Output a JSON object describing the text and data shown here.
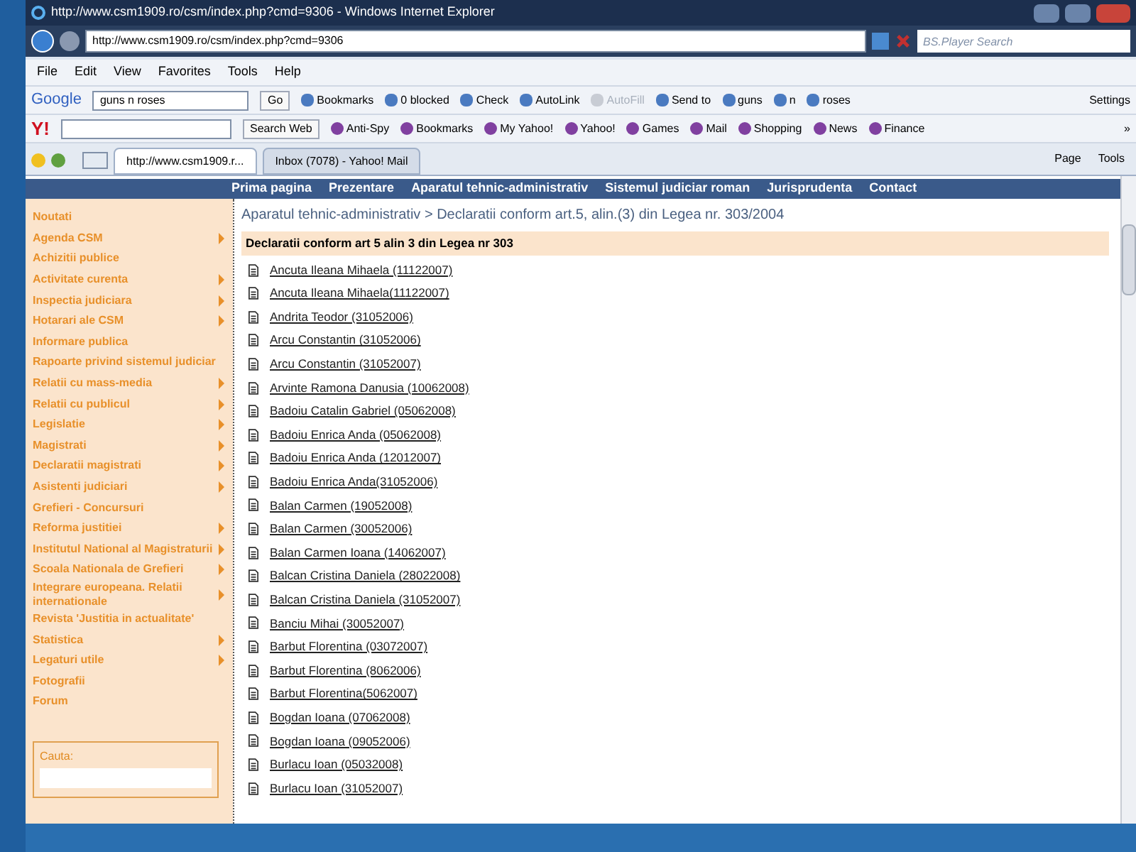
{
  "window": {
    "title": "http://www.csm1909.ro/csm/index.php?cmd=9306 - Windows Internet Explorer"
  },
  "address_bar": {
    "url": "http://www.csm1909.ro/csm/index.php?cmd=9306",
    "search_placeholder": "BS.Player Search"
  },
  "menu": [
    "File",
    "Edit",
    "View",
    "Favorites",
    "Tools",
    "Help"
  ],
  "google_toolbar": {
    "logo": "Google",
    "query": "guns n roses",
    "go": "Go",
    "items": [
      {
        "label": "Bookmarks",
        "disabled": false
      },
      {
        "label": "0 blocked",
        "disabled": false
      },
      {
        "label": "Check",
        "disabled": false
      },
      {
        "label": "AutoLink",
        "disabled": false
      },
      {
        "label": "AutoFill",
        "disabled": true
      },
      {
        "label": "Send to",
        "disabled": false
      },
      {
        "label": "guns",
        "disabled": false
      },
      {
        "label": "n",
        "disabled": false
      },
      {
        "label": "roses",
        "disabled": false
      }
    ],
    "settings": "Settings"
  },
  "yahoo_toolbar": {
    "logo": "Y!",
    "search_button": "Search Web",
    "items": [
      "Anti-Spy",
      "Bookmarks",
      "My Yahoo!",
      "Yahoo!",
      "Games",
      "Mail",
      "Shopping",
      "News",
      "Finance"
    ],
    "more": "»"
  },
  "tabs": [
    {
      "label": "http://www.csm1909.r...",
      "selected": true
    },
    {
      "label": "Inbox (7078) - Yahoo! Mail",
      "selected": false
    }
  ],
  "command_bar": [
    "Page",
    "Tools"
  ],
  "site_nav": [
    "Prima pagina",
    "Prezentare",
    "Aparatul tehnic-administrativ",
    "Sistemul judiciar roman",
    "Jurisprudenta",
    "Contact"
  ],
  "sidebar": {
    "items": [
      {
        "label": "Noutati",
        "submenu": false
      },
      {
        "label": "Agenda CSM",
        "submenu": true
      },
      {
        "label": "Achizitii publice",
        "submenu": false
      },
      {
        "label": "Activitate curenta",
        "submenu": true
      },
      {
        "label": "Inspectia judiciara",
        "submenu": true
      },
      {
        "label": "Hotarari ale CSM",
        "submenu": true
      },
      {
        "label": "Informare publica",
        "submenu": false
      },
      {
        "label": "Rapoarte privind sistemul judiciar",
        "submenu": false
      },
      {
        "label": "Relatii cu mass-media",
        "submenu": true
      },
      {
        "label": "Relatii cu publicul",
        "submenu": true
      },
      {
        "label": "Legislatie",
        "submenu": true
      },
      {
        "label": "Magistrati",
        "submenu": true
      },
      {
        "label": "Declaratii magistrati",
        "submenu": true
      },
      {
        "label": "Asistenti judiciari",
        "submenu": true
      },
      {
        "label": "Grefieri - Concursuri",
        "submenu": false
      },
      {
        "label": "Reforma justitiei",
        "submenu": true
      },
      {
        "label": "Institutul National al Magistraturii",
        "submenu": true
      },
      {
        "label": "Scoala Nationala de Grefieri",
        "submenu": true
      },
      {
        "label": "Integrare europeana. Relatii internationale",
        "submenu": true
      },
      {
        "label": "Revista 'Justitia in actualitate'",
        "submenu": false
      },
      {
        "label": "Statistica",
        "submenu": true
      },
      {
        "label": "Legaturi utile",
        "submenu": true
      },
      {
        "label": "Fotografii",
        "submenu": false
      },
      {
        "label": "Forum",
        "submenu": false
      }
    ],
    "search_label": "Cauta:"
  },
  "breadcrumb": "Aparatul tehnic-administrativ > Declaratii conform art.5, alin.(3) din Legea nr. 303/2004",
  "section_heading": "Declaratii conform art 5 alin 3 din Legea nr 303",
  "documents": [
    "Ancuta Ileana Mihaela (11122007)",
    "Ancuta Ileana Mihaela(11122007)",
    "Andrita Teodor (31052006)",
    "Arcu Constantin (31052006)",
    "Arcu Constantin (31052007)",
    "Arvinte Ramona Danusia (10062008)",
    "Badoiu Catalin Gabriel (05062008)",
    "Badoiu Enrica Anda (05062008)",
    "Badoiu Enrica Anda (12012007)",
    "Badoiu Enrica Anda(31052006)",
    "Balan Carmen (19052008)",
    "Balan Carmen (30052006)",
    "Balan Carmen Ioana (14062007)",
    "Balcan Cristina Daniela (28022008)",
    "Balcan Cristina Daniela (31052007)",
    "Banciu Mihai (30052007)",
    "Barbut Florentina (03072007)",
    "Barbut Florentina (8062006)",
    "Barbut Florentina(5062007)",
    "Bogdan Ioana (07062008)",
    "Bogdan Ioana (09052006)",
    "Burlacu Ioan (05032008)",
    "Burlacu Ioan (31052007)"
  ]
}
